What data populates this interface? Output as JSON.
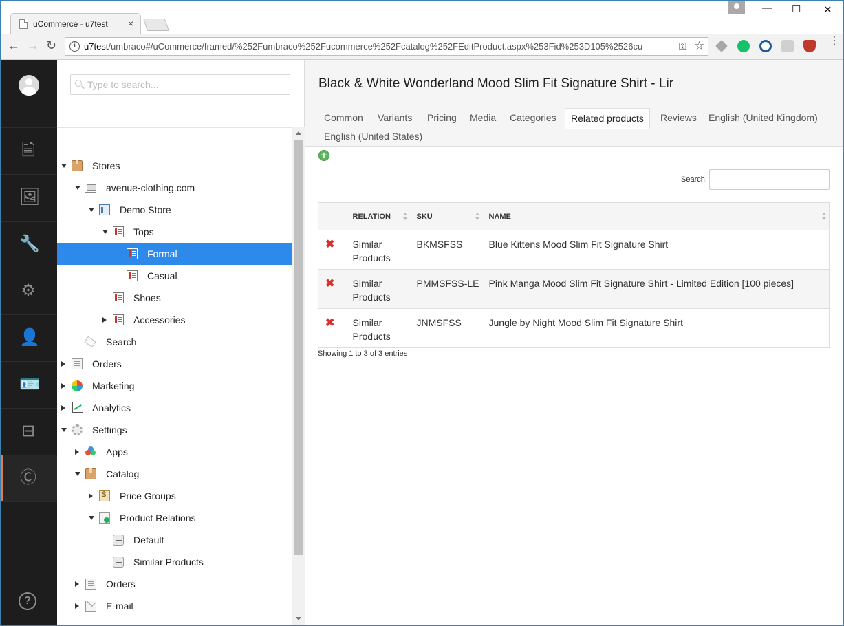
{
  "browser": {
    "tab_title": "uCommerce - u7test",
    "tab_close": "×",
    "window_controls": {
      "minimize": "—",
      "maximize": "☐",
      "close": "✕"
    },
    "nav": {
      "back": "←",
      "forward": "→",
      "reload": "↻"
    },
    "url_prefix": "u7test",
    "url_rest": "/umbraco#/uCommerce/framed/%252Fumbraco%252Fucommerce%252Fcatalog%252FEditProduct.aspx%253Fid%253D105%2526cu",
    "info_icon": "i",
    "key_icon": "⚿",
    "star_icon": "☆",
    "menu_icon": "⋮",
    "extension_colors": [
      "#a8a8a8",
      "#15c26b",
      "#1b5e9e",
      "#d0d0d0",
      "#c0392b"
    ]
  },
  "rail": {
    "sections": [
      {
        "name": "content-section",
        "icon": "🗎"
      },
      {
        "name": "media-section",
        "icon": "🖼"
      },
      {
        "name": "settings-wrench-section",
        "icon": "🔧"
      },
      {
        "name": "developer-gear-section",
        "icon": "⚙"
      },
      {
        "name": "users-section",
        "icon": "👤"
      },
      {
        "name": "members-section",
        "icon": "🪪"
      },
      {
        "name": "forms-section",
        "icon": "⊟"
      },
      {
        "name": "ucommerce-section",
        "icon": "Ⓒ"
      }
    ],
    "help": "?",
    "accent_color": "#e07c4b"
  },
  "tree": {
    "search_placeholder": "Type to search...",
    "nodes": [
      {
        "label": "Stores"
      },
      {
        "label": "avenue-clothing.com"
      },
      {
        "label": "Demo Store"
      },
      {
        "label": "Tops"
      },
      {
        "label": "Formal"
      },
      {
        "label": "Casual"
      },
      {
        "label": "Shoes"
      },
      {
        "label": "Accessories"
      },
      {
        "label": "Search"
      },
      {
        "label": "Orders"
      },
      {
        "label": "Marketing"
      },
      {
        "label": "Analytics"
      },
      {
        "label": "Settings"
      },
      {
        "label": "Apps"
      },
      {
        "label": "Catalog"
      },
      {
        "label": "Price Groups"
      },
      {
        "label": "Product Relations"
      },
      {
        "label": "Default"
      },
      {
        "label": "Similar Products"
      },
      {
        "label": "Orders"
      },
      {
        "label": "E-mail"
      }
    ],
    "selected_color": "#2e8aea"
  },
  "editor": {
    "title": "Black & White Wonderland Mood Slim Fit Signature Shirt - Lir",
    "tabs": [
      "Common",
      "Variants",
      "Pricing",
      "Media",
      "Categories",
      "Related products",
      "Reviews",
      "English (United Kingdom)",
      "English (United States)"
    ],
    "add_icon": "+",
    "search_label": "Search:",
    "columns": [
      "RELATION",
      "SKU",
      "NAME"
    ],
    "rows": [
      {
        "relation": "Similar Products",
        "sku": "BKMSFSS",
        "name": "Blue Kittens Mood Slim Fit Signature Shirt"
      },
      {
        "relation": "Similar Products",
        "sku": "PMMSFSS-LE",
        "name": "Pink Manga Mood Slim Fit Signature Shirt - Limited Edition [100 pieces]"
      },
      {
        "relation": "Similar Products",
        "sku": "JNMSFSS",
        "name": "Jungle by Night Mood Slim Fit Signature Shirt"
      }
    ],
    "delete_icon": "✖",
    "info": "Showing 1 to 3 of 3 entries"
  }
}
